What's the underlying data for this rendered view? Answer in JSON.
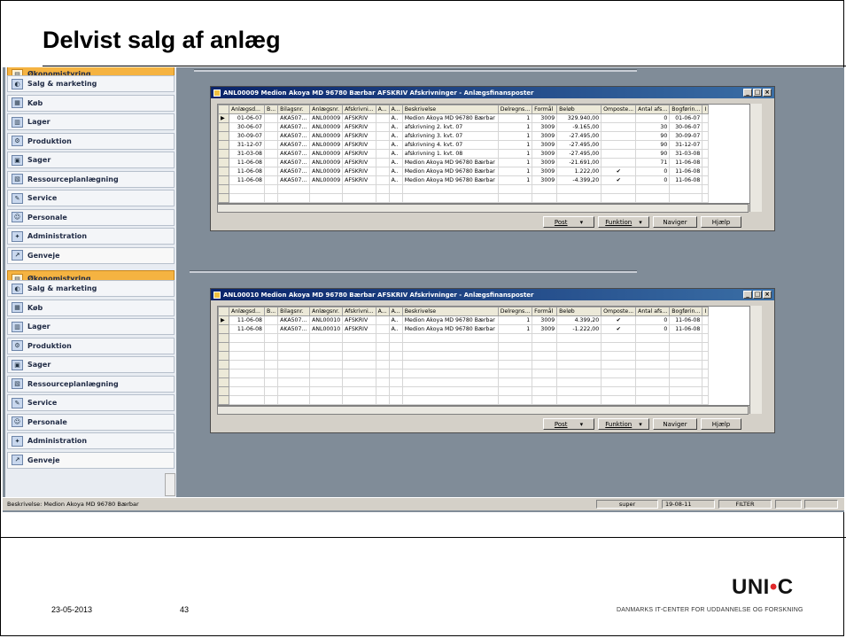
{
  "slide": {
    "title": "Delvist salg af anlæg",
    "date": "23-05-2013",
    "page_number": "43",
    "logo_left": "UNI",
    "logo_dot": "•",
    "logo_right": "C",
    "logo_subtitle": "DANMARKS IT-CENTER FOR UDDANNELSE OG FORSKNING"
  },
  "nav_top": [
    {
      "label": "Økonomistyring",
      "icon": "finance-icon"
    },
    {
      "label": "Salg & marketing",
      "icon": "sales-icon"
    },
    {
      "label": "Køb",
      "icon": "purchase-icon"
    },
    {
      "label": "Lager",
      "icon": "warehouse-icon"
    },
    {
      "label": "Produktion",
      "icon": "production-icon"
    },
    {
      "label": "Sager",
      "icon": "jobs-icon"
    },
    {
      "label": "Ressourceplanlægning",
      "icon": "resource-icon"
    },
    {
      "label": "Service",
      "icon": "service-icon"
    },
    {
      "label": "Personale",
      "icon": "personnel-icon"
    },
    {
      "label": "Administration",
      "icon": "admin-icon"
    },
    {
      "label": "Genveje",
      "icon": "shortcut-icon"
    }
  ],
  "nav_bottom": [
    {
      "label": "Økonomistyring",
      "icon": "finance-icon"
    },
    {
      "label": "Salg & marketing",
      "icon": "sales-icon"
    },
    {
      "label": "Køb",
      "icon": "purchase-icon"
    },
    {
      "label": "Lager",
      "icon": "warehouse-icon"
    },
    {
      "label": "Produktion",
      "icon": "production-icon"
    },
    {
      "label": "Sager",
      "icon": "jobs-icon"
    },
    {
      "label": "Ressourceplanlægning",
      "icon": "resource-icon"
    },
    {
      "label": "Service",
      "icon": "service-icon"
    },
    {
      "label": "Personale",
      "icon": "personnel-icon"
    },
    {
      "label": "Administration",
      "icon": "admin-icon"
    },
    {
      "label": "Genveje",
      "icon": "shortcut-icon"
    }
  ],
  "columns": [
    "Anlægsd...",
    "B...",
    "Bilagsnr.",
    "Anlægsnr.",
    "Afskrivni...",
    "A...",
    "A...",
    "Beskrivelse",
    "Delregns...",
    "Formål",
    "Beløb",
    "Omposte...",
    "Antal afs...",
    "Bogførin...",
    "I"
  ],
  "window1": {
    "title": "ANL00009 Medion Akoya MD 96780 Bærbar AFSKRIV Afskrivninger - Anlægsfinansposter",
    "rows": [
      [
        "01-06-07",
        "",
        "AKA507...",
        "ANL00009",
        "AFSKRIV",
        "",
        "A..",
        "Medion Akoya MD 96780 Bærbar",
        "1",
        "3009",
        "329.940,00",
        "",
        "0",
        "01-06-07"
      ],
      [
        "30-06-07",
        "",
        "AKA507...",
        "ANL00009",
        "AFSKRIV",
        "",
        "A..",
        "afskrivning 2. kvt. 07",
        "1",
        "3009",
        "-9.165,00",
        "",
        "30",
        "30-06-07"
      ],
      [
        "30-09-07",
        "",
        "AKA507...",
        "ANL00009",
        "AFSKRIV",
        "",
        "A..",
        "afskrivning 3. kvt. 07",
        "1",
        "3009",
        "-27.495,00",
        "",
        "90",
        "30-09-07"
      ],
      [
        "31-12-07",
        "",
        "AKA507...",
        "ANL00009",
        "AFSKRIV",
        "",
        "A..",
        "afskrivning 4. kvt. 07",
        "1",
        "3009",
        "-27.495,00",
        "",
        "90",
        "31-12-07"
      ],
      [
        "31-03-08",
        "",
        "AKA507...",
        "ANL00009",
        "AFSKRIV",
        "",
        "A..",
        "afskrivning 1. kvt. 08",
        "1",
        "3009",
        "-27.495,00",
        "",
        "90",
        "31-03-08"
      ],
      [
        "11-06-08",
        "",
        "AKA507...",
        "ANL00009",
        "AFSKRIV",
        "",
        "A..",
        "Medion Akoya MD 96780 Bærbar",
        "1",
        "3009",
        "-21.691,00",
        "",
        "71",
        "11-06-08"
      ],
      [
        "11-06-08",
        "",
        "AKA507...",
        "ANL00009",
        "AFSKRIV",
        "",
        "A..",
        "Medion Akoya MD 96780 Bærbar",
        "1",
        "3009",
        "1.222,00",
        "✔",
        "0",
        "11-06-08"
      ],
      [
        "11-06-08",
        "",
        "AKA507...",
        "ANL00009",
        "AFSKRIV",
        "",
        "A..",
        "Medion Akoya MD 96780 Bærbar",
        "1",
        "3009",
        "-4.399,20",
        "✔",
        "0",
        "11-06-08"
      ]
    ],
    "empty_rows": 3
  },
  "window2": {
    "title": "ANL00010 Medion Akoya MD 96780 Bærbar AFSKRIV Afskrivninger - Anlægsfinansposter",
    "rows": [
      [
        "11-06-08",
        "",
        "AKA507...",
        "ANL00010",
        "AFSKRIV",
        "",
        "A..",
        "Medion Akoya MD 96780 Bærbar",
        "1",
        "3009",
        "4.399,20",
        "✔",
        "0",
        "11-06-08"
      ],
      [
        "11-06-08",
        "",
        "AKA507...",
        "ANL00010",
        "AFSKRIV",
        "",
        "A..",
        "Medion Akoya MD 96780 Bærbar",
        "1",
        "3009",
        "-1.222,00",
        "✔",
        "0",
        "11-06-08"
      ]
    ],
    "empty_rows": 9
  },
  "buttons": {
    "post": "Post",
    "function": "Funktion",
    "navigate": "Naviger",
    "help": "Hjælp"
  },
  "statusbar": {
    "description": "Beskrivelse: Medion Akoya MD 96780 Bærbar",
    "user": "super",
    "date": "19-08-11",
    "filter": "FILTER"
  }
}
